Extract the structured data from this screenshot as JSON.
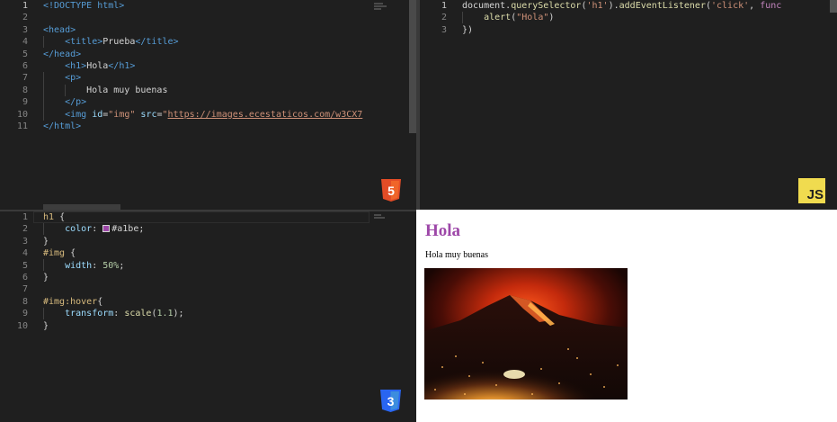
{
  "html_editor": {
    "lines": [
      {
        "n": "1",
        "parts": [
          [
            "t-tag",
            "<!DOCTYPE html>"
          ]
        ]
      },
      {
        "n": "2",
        "parts": []
      },
      {
        "n": "3",
        "parts": [
          [
            "t-tag",
            "<head>"
          ]
        ]
      },
      {
        "n": "4",
        "parts": [
          [
            "t-txt",
            "    "
          ],
          [
            "t-tag",
            "<title>"
          ],
          [
            "t-txt",
            "Prueba"
          ],
          [
            "t-tag",
            "</title>"
          ]
        ]
      },
      {
        "n": "5",
        "parts": [
          [
            "t-tag",
            "</head>"
          ]
        ]
      },
      {
        "n": "6",
        "parts": [
          [
            "t-txt",
            "    "
          ],
          [
            "t-tag",
            "<h1>"
          ],
          [
            "t-txt",
            "Hola"
          ],
          [
            "t-tag",
            "</h1>"
          ]
        ]
      },
      {
        "n": "7",
        "parts": [
          [
            "t-txt",
            "    "
          ],
          [
            "t-tag",
            "<p>"
          ]
        ]
      },
      {
        "n": "8",
        "parts": [
          [
            "t-txt",
            "        Hola muy buenas"
          ]
        ]
      },
      {
        "n": "9",
        "parts": [
          [
            "t-txt",
            "    "
          ],
          [
            "t-tag",
            "</p>"
          ]
        ]
      },
      {
        "n": "10",
        "parts": [
          [
            "t-txt",
            "    "
          ],
          [
            "t-tag",
            "<img "
          ],
          [
            "t-attr",
            "id"
          ],
          [
            "t-punc",
            "="
          ],
          [
            "t-str",
            "\"img\""
          ],
          [
            "t-punc",
            " "
          ],
          [
            "t-attr",
            "src"
          ],
          [
            "t-punc",
            "="
          ],
          [
            "t-str",
            "\""
          ],
          [
            "t-url",
            "https://images.ecestaticos.com/w3CX7"
          ]
        ]
      },
      {
        "n": "11",
        "parts": [
          [
            "t-tag",
            "</html>"
          ]
        ]
      }
    ],
    "badge_label": "5"
  },
  "js_editor": {
    "lines": [
      {
        "n": "1",
        "parts": [
          [
            "t-txt",
            "document."
          ],
          [
            "t-fn",
            "querySelector"
          ],
          [
            "t-punc",
            "("
          ],
          [
            "t-str",
            "'h1'"
          ],
          [
            "t-punc",
            ")."
          ],
          [
            "t-fn",
            "addEventListener"
          ],
          [
            "t-punc",
            "("
          ],
          [
            "t-str",
            "'click'"
          ],
          [
            "t-punc",
            ", "
          ],
          [
            "t-kw",
            "func"
          ]
        ]
      },
      {
        "n": "2",
        "parts": [
          [
            "t-txt",
            "    "
          ],
          [
            "t-fn",
            "alert"
          ],
          [
            "t-punc",
            "("
          ],
          [
            "t-str",
            "\"Hola\""
          ],
          [
            "t-punc",
            ")"
          ]
        ]
      },
      {
        "n": "3",
        "parts": [
          [
            "t-punc",
            "})"
          ]
        ]
      }
    ],
    "badge_label": "JS"
  },
  "css_editor": {
    "lines": [
      {
        "n": "1",
        "parts": [
          [
            "t-sel",
            "h1"
          ],
          [
            "t-punc",
            " {"
          ]
        ]
      },
      {
        "n": "2",
        "parts": [
          [
            "t-txt",
            "    "
          ],
          [
            "t-prop",
            "color"
          ],
          [
            "t-punc",
            ": "
          ],
          [
            "swatch",
            "#a1be"
          ],
          [
            "t-txt",
            "#a1be"
          ],
          [
            "t-punc",
            ";"
          ]
        ]
      },
      {
        "n": "3",
        "parts": [
          [
            "t-punc",
            "}"
          ]
        ]
      },
      {
        "n": "4",
        "parts": [
          [
            "t-sel",
            "#img"
          ],
          [
            "t-punc",
            " {"
          ]
        ]
      },
      {
        "n": "5",
        "parts": [
          [
            "t-txt",
            "    "
          ],
          [
            "t-prop",
            "width"
          ],
          [
            "t-punc",
            ": "
          ],
          [
            "t-num",
            "50%"
          ],
          [
            "t-punc",
            ";"
          ]
        ]
      },
      {
        "n": "6",
        "parts": [
          [
            "t-punc",
            "}"
          ]
        ]
      },
      {
        "n": "7",
        "parts": []
      },
      {
        "n": "8",
        "parts": [
          [
            "t-sel",
            "#img:hover"
          ],
          [
            "t-punc",
            "{"
          ]
        ]
      },
      {
        "n": "9",
        "parts": [
          [
            "t-txt",
            "    "
          ],
          [
            "t-prop",
            "transform"
          ],
          [
            "t-punc",
            ": "
          ],
          [
            "t-fn",
            "scale"
          ],
          [
            "t-punc",
            "("
          ],
          [
            "t-num",
            "1.1"
          ],
          [
            "t-punc",
            ");"
          ]
        ]
      },
      {
        "n": "10",
        "parts": [
          [
            "t-punc",
            "}"
          ]
        ]
      }
    ],
    "badge_label": "3"
  },
  "output": {
    "heading": "Hola",
    "paragraph": "Hola muy buenas",
    "heading_color": "#9d47a8"
  },
  "colors": {
    "editor_bg": "#1f1f1f",
    "html5_badge": "#e34c26",
    "css3_badge": "#2965f1",
    "js_badge": "#f0db4f"
  }
}
